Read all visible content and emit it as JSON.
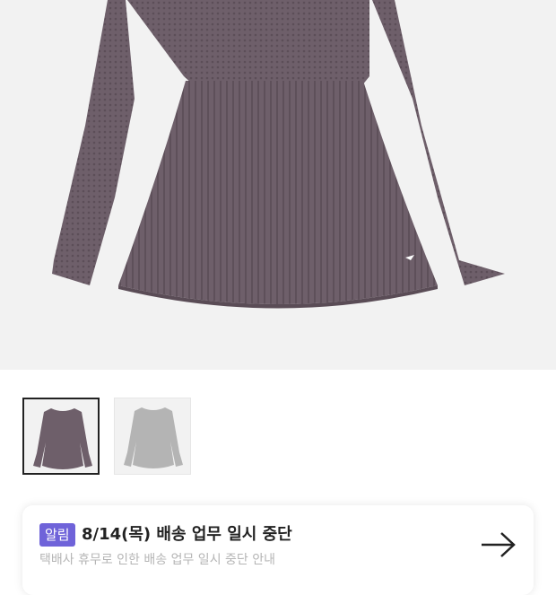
{
  "product": {
    "main_image": "knit-sweater-dress-purple-gray",
    "thumbnails": [
      {
        "name": "purple-gray-knit-dress",
        "color": "#6e5f6a",
        "selected": true
      },
      {
        "name": "light-gray-knit-dress",
        "color": "#b4b4b4",
        "selected": false
      }
    ]
  },
  "notice": {
    "badge": "알림",
    "title": "8/14(목) 배송 업무 일시 중단",
    "subtitle": "택배사 휴무로 인한 배송 업무 일시 중단 안내",
    "arrow_icon": "arrow-right-icon"
  },
  "colors": {
    "badge": "#6f63d9",
    "background_gray": "#f2f2f2",
    "garment": "#6e5f6a"
  }
}
